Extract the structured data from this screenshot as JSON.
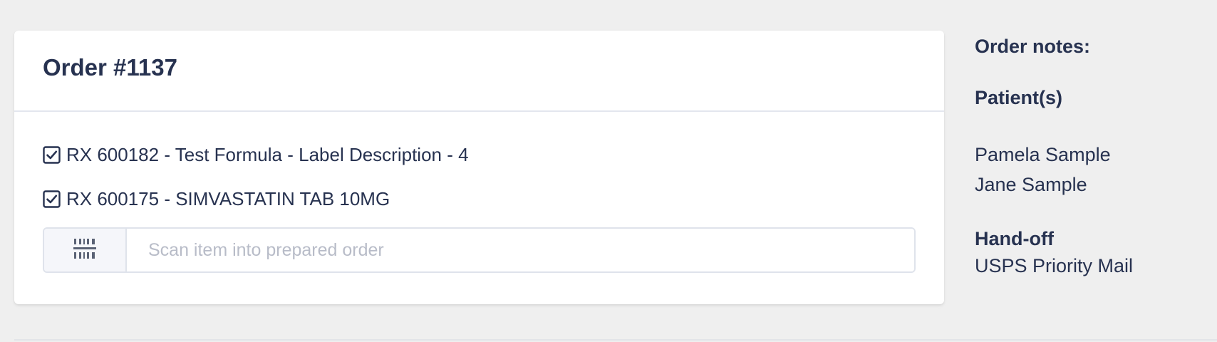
{
  "order": {
    "title": "Order #1137",
    "items": [
      {
        "label": "RX 600182 - Test Formula - Label Description - 4",
        "checked": true
      },
      {
        "label": "RX 600175 - SIMVASTATIN TAB 10MG",
        "checked": true
      }
    ],
    "scan": {
      "placeholder": "Scan item into prepared order",
      "value": "",
      "icon": "barcode-icon"
    }
  },
  "side": {
    "notes_label": "Order notes:",
    "patients_label": "Patient(s)",
    "patients": [
      "Pamela Sample",
      "Jane Sample"
    ],
    "handoff_label": "Hand-off",
    "handoff_value": "USPS Priority Mail"
  },
  "colors": {
    "background": "#efefef",
    "card": "#ffffff",
    "text": "#273250",
    "border": "#dfe3eb",
    "placeholder": "#b8bcc8"
  }
}
